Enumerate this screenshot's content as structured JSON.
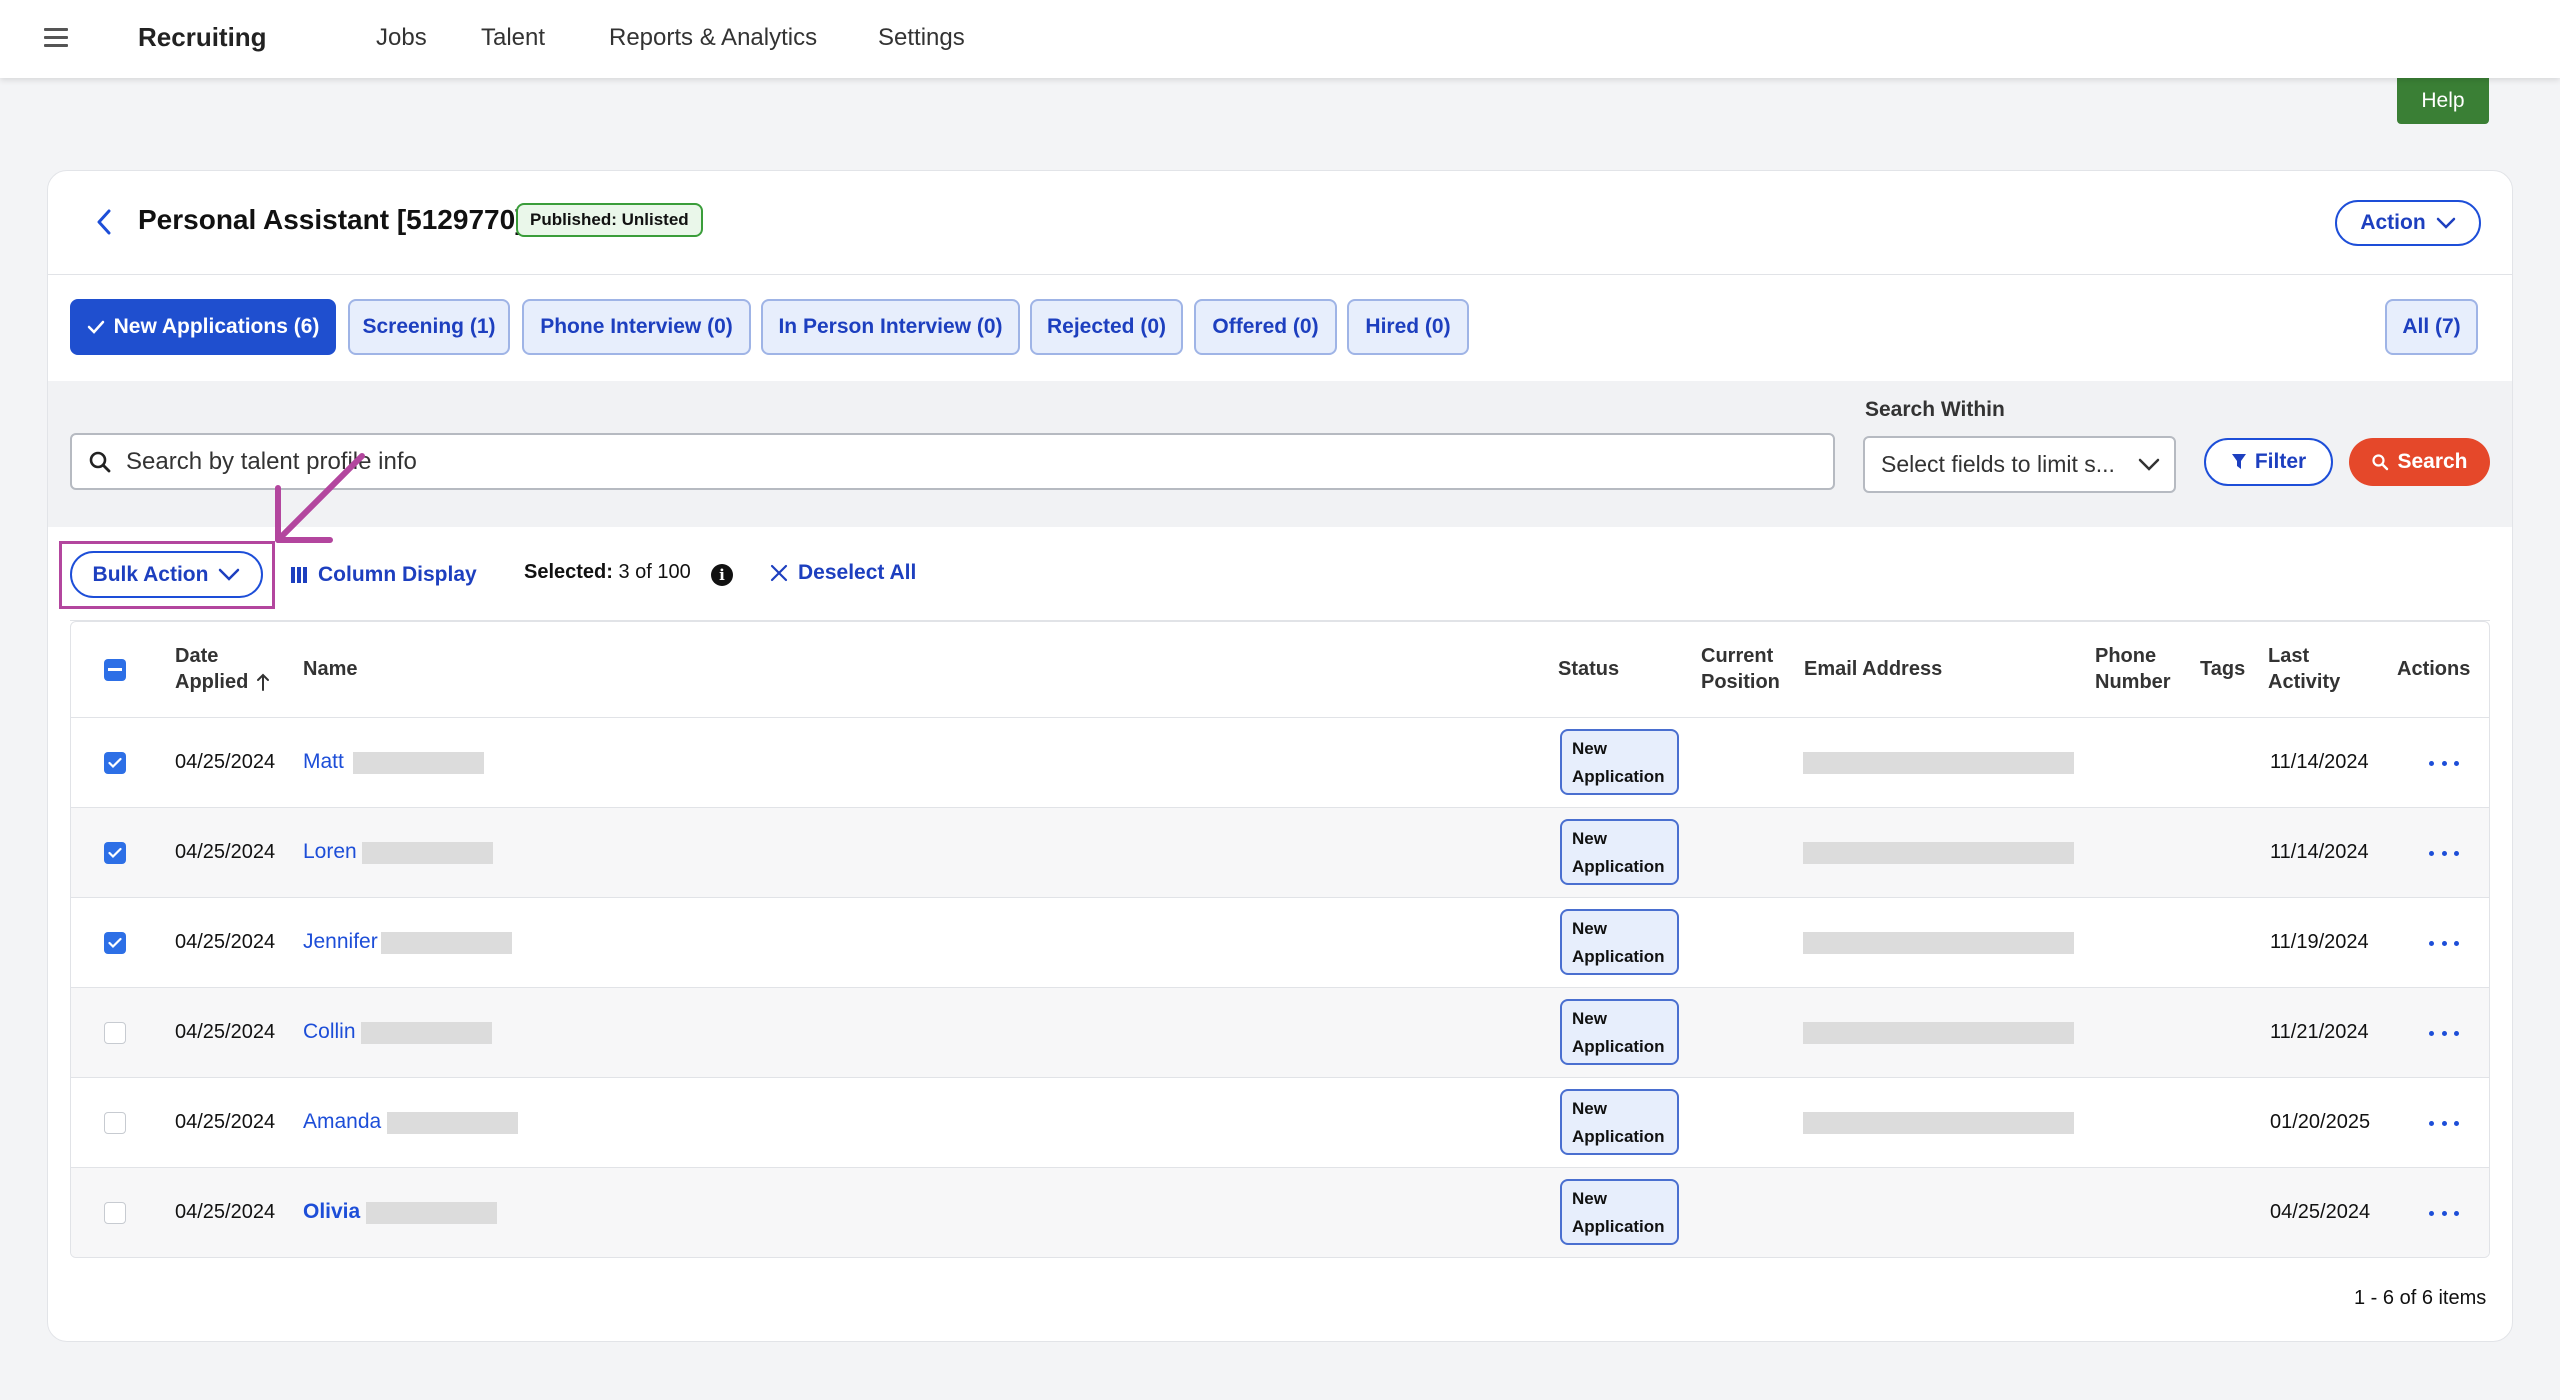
{
  "nav": {
    "brand": "Recruiting",
    "links": [
      "Jobs",
      "Talent",
      "Reports & Analytics",
      "Settings"
    ]
  },
  "help_label": "Help",
  "job": {
    "title": "Personal Assistant [5129770]",
    "badge": "Published: Unlisted",
    "action_label": "Action"
  },
  "tabs": [
    {
      "label": "New Applications (6)",
      "active": true
    },
    {
      "label": "Screening (1)"
    },
    {
      "label": "Phone Interview (0)"
    },
    {
      "label": "In Person Interview (0)"
    },
    {
      "label": "Rejected (0)"
    },
    {
      "label": "Offered (0)"
    },
    {
      "label": "Hired (0)"
    },
    {
      "label": "All (7)"
    }
  ],
  "search": {
    "placeholder": "Search by talent profile info",
    "within_label": "Search Within",
    "within_value": "Select fields to limit s...",
    "filter_label": "Filter",
    "search_label": "Search"
  },
  "toolbar": {
    "bulk_action": "Bulk Action",
    "column_display": "Column Display",
    "selected_label": "Selected:",
    "selected_value": "3 of 100",
    "deselect_all": "Deselect All"
  },
  "columns": {
    "date_applied_1": "Date",
    "date_applied_2": "Applied",
    "name": "Name",
    "status": "Status",
    "current_position_1": "Current",
    "current_position_2": "Position",
    "email": "Email Address",
    "phone_1": "Phone",
    "phone_2": "Number",
    "tags": "Tags",
    "last_activity_1": "Last",
    "last_activity_2": "Activity",
    "actions": "Actions"
  },
  "rows": [
    {
      "checked": true,
      "date": "04/25/2024",
      "name": "Matt",
      "status_1": "New",
      "status_2": "Application",
      "has_email": true,
      "last_activity": "11/14/2024"
    },
    {
      "checked": true,
      "date": "04/25/2024",
      "name": "Loren",
      "status_1": "New",
      "status_2": "Application",
      "has_email": true,
      "last_activity": "11/14/2024"
    },
    {
      "checked": true,
      "date": "04/25/2024",
      "name": "Jennifer",
      "status_1": "New",
      "status_2": "Application",
      "has_email": true,
      "last_activity": "11/19/2024"
    },
    {
      "checked": false,
      "date": "04/25/2024",
      "name": "Collin",
      "status_1": "New",
      "status_2": "Application",
      "has_email": true,
      "last_activity": "11/21/2024"
    },
    {
      "checked": false,
      "date": "04/25/2024",
      "name": "Amanda",
      "status_1": "New",
      "status_2": "Application",
      "has_email": true,
      "last_activity": "01/20/2025"
    },
    {
      "checked": false,
      "date": "04/25/2024",
      "name": "Olivia",
      "bold": true,
      "status_1": "New",
      "status_2": "Application",
      "has_email": false,
      "last_activity": "04/25/2024"
    }
  ],
  "pager": "1 - 6 of 6 items",
  "colors": {
    "primary": "#1d4ed8",
    "active_tab": "#1f4fcf",
    "search_button": "#e5482a",
    "help_button": "#3a7f35",
    "highlight": "#b3469e"
  }
}
